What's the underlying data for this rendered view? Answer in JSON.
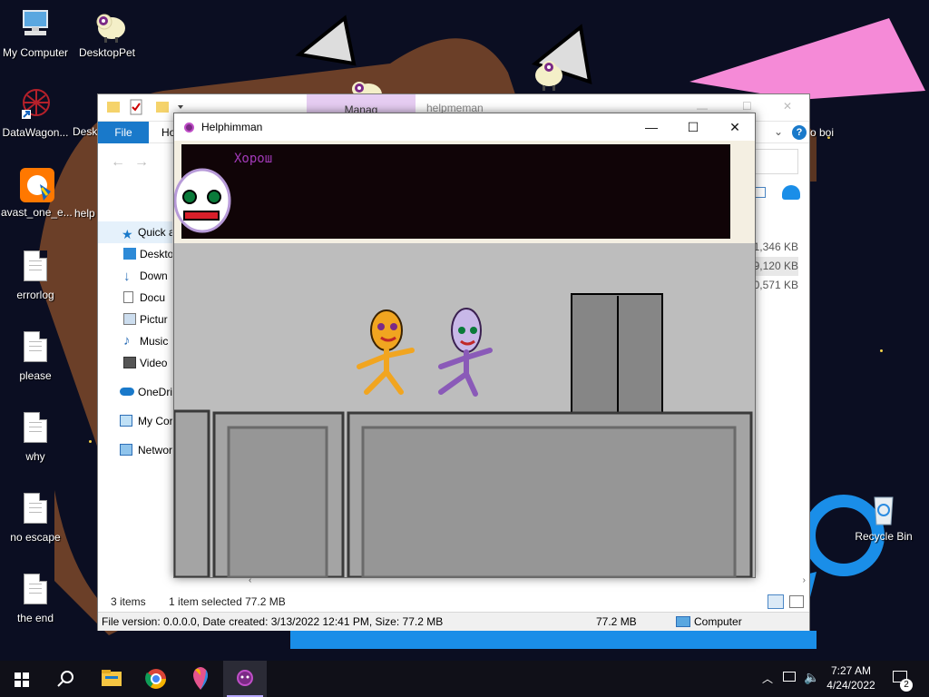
{
  "desktop": {
    "icons_left": [
      {
        "label": "My Computer",
        "icon": "computer-icon"
      },
      {
        "label": "DataWagon...",
        "icon": "datawagon-icon"
      },
      {
        "label": "avast_one_e...",
        "icon": "avast-installer-icon"
      },
      {
        "label": "errorlog",
        "icon": "text-file-icon"
      },
      {
        "label": "please",
        "icon": "text-file-icon"
      },
      {
        "label": "why",
        "icon": "text-file-icon"
      },
      {
        "label": "no escape",
        "icon": "text-file-icon"
      },
      {
        "label": "the end",
        "icon": "text-file-icon"
      }
    ],
    "icons_second_col": [
      {
        "label": "DesktopPet",
        "icon": "sheep-pet-icon"
      },
      {
        "label": "Desk",
        "icon": "folder-icon"
      },
      {
        "label": "help",
        "icon": "folder-icon"
      }
    ],
    "recycle_bin": {
      "label": "Recycle Bin",
      "icon": "recycle-bin-icon"
    },
    "right_partial_label": "o boi"
  },
  "explorer": {
    "tab_manage": "Manag",
    "title": "helpmeman",
    "ribbon": {
      "file": "File",
      "home": "Ho"
    },
    "nav": [
      {
        "label": "Quick a",
        "icon": "star-icon"
      },
      {
        "label": "Deskto",
        "icon": "desktop-icon"
      },
      {
        "label": "Down",
        "icon": "download-icon"
      },
      {
        "label": "Docu",
        "icon": "document-icon"
      },
      {
        "label": "Pictur",
        "icon": "pictures-icon"
      },
      {
        "label": "Music",
        "icon": "music-icon"
      },
      {
        "label": "Video",
        "icon": "video-icon"
      },
      {
        "label": "OneDriv",
        "icon": "onedrive-icon"
      },
      {
        "label": "My Cor",
        "icon": "computer-icon"
      },
      {
        "label": "Networ",
        "icon": "network-icon"
      }
    ],
    "sizes": [
      "1,346 KB",
      "9,120 KB",
      "0,571 KB"
    ],
    "status": {
      "items": "3 items",
      "selected": "1 item selected  77.2 MB"
    },
    "details": {
      "info": "File version: 0.0.0.0, Date created: 3/13/2022 12:41 PM, Size: 77.2 MB",
      "size": "77.2 MB",
      "location": "Computer"
    }
  },
  "game": {
    "title": "Helphimman",
    "speech": "Хорош",
    "controls": {
      "minimize": "—",
      "maximize": "☐",
      "close": "✕"
    }
  },
  "taskbar": {
    "apps": [
      "start-icon",
      "search-icon",
      "file-explorer-icon",
      "chrome-icon",
      "paint3d-icon",
      "helphimman-icon"
    ],
    "clock": {
      "time": "7:27 AM",
      "date": "4/24/2022"
    },
    "notifications": "2"
  }
}
